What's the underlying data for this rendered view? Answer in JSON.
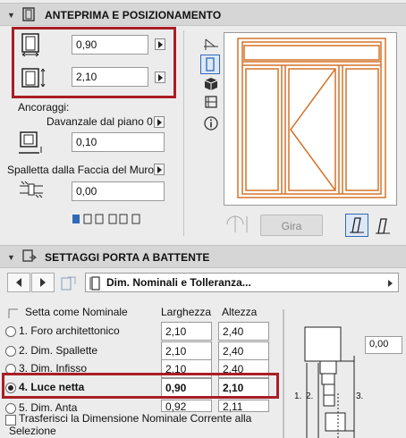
{
  "section1": {
    "title": "ANTEPRIMA E POSIZIONAMENTO",
    "width_value": "0,90",
    "height_value": "2,10",
    "anchors_label": "Ancoraggi:",
    "sill_label": "Davanzale dal piano 0",
    "sill_value": "0,10",
    "reveal_label": "Spalletta dalla Faccia del Muro",
    "reveal_value": "0,00",
    "flip_button": "Gira"
  },
  "section2": {
    "title": "SETTAGGI PORTA A BATTENTE",
    "dropdown_value": "Dim. Nominali e Tolleranza...",
    "set_nominal_label": "Setta come Nominale",
    "col_width": "Larghezza",
    "col_height": "Altezza",
    "rows": [
      {
        "label": "1. Foro architettonico",
        "width": "2,10",
        "height": "2,40",
        "selected": false
      },
      {
        "label": "2. Dim. Spallette",
        "width": "2,10",
        "height": "2,40",
        "selected": false
      },
      {
        "label": "3. Dim. Infisso",
        "width": "2,10",
        "height": "2,40",
        "selected": false
      },
      {
        "label": "4. Luce netta",
        "width": "0,90",
        "height": "2,10",
        "selected": true
      },
      {
        "label": "5. Dim. Anta",
        "width": "0,92",
        "height": "2,11",
        "selected": false
      }
    ],
    "transfer_label_1": "Trasferisci la Dimensione Nominale Corrente alla",
    "transfer_label_2": "Selezione",
    "diagram_value": "0,00",
    "diagram_labels": [
      "1.",
      "2.",
      "3."
    ]
  },
  "colors": {
    "highlight_red": "#a81e25",
    "door_orange": "#d4732a",
    "accent_blue": "#2f6ab5"
  }
}
